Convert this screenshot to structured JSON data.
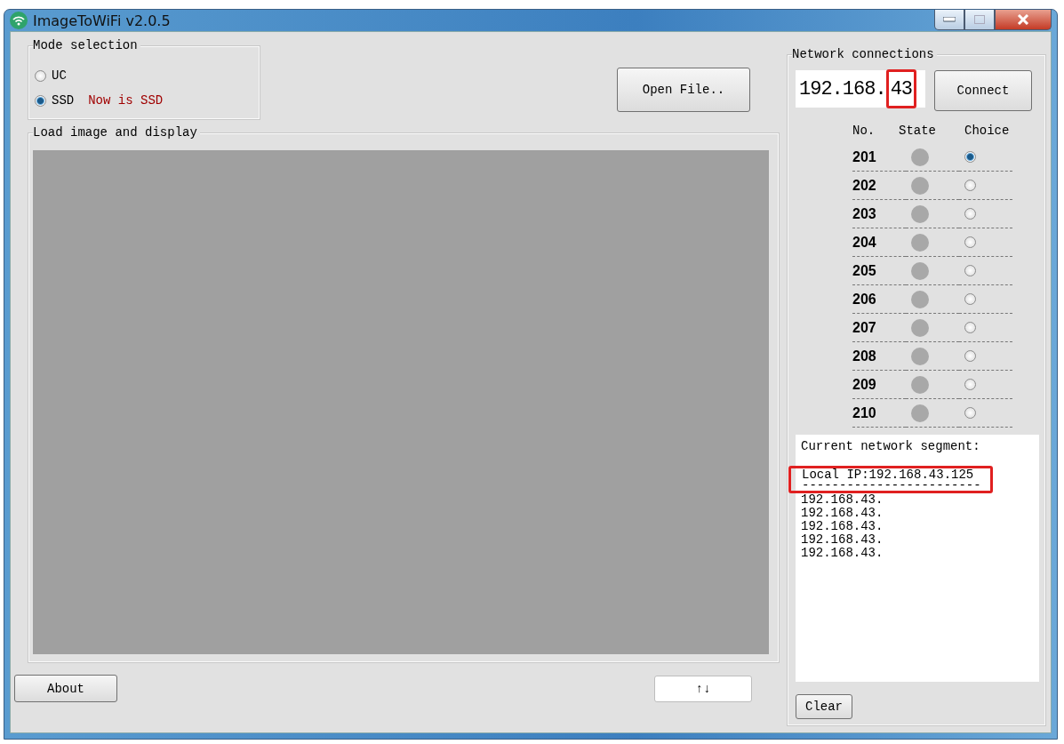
{
  "window": {
    "title": "ImageToWiFi v2.0.5"
  },
  "mode_selection": {
    "title": "Mode selection",
    "options": [
      {
        "label": "UC",
        "selected": false
      },
      {
        "label": "SSD",
        "selected": true
      }
    ],
    "status": "Now is SSD"
  },
  "open_file_button": "Open File..",
  "display": {
    "title": "Load image and display"
  },
  "about_button": "About",
  "swap_button": "↑↓",
  "network": {
    "title": "Network connections",
    "ip_field": {
      "value": "192.168.",
      "suffix": "43",
      "highlighted": true
    },
    "connect_button": "Connect",
    "columns": [
      "No.",
      "State",
      "Choice"
    ],
    "devices": [
      {
        "no": "201",
        "online": false,
        "selected": true
      },
      {
        "no": "202",
        "online": false,
        "selected": false
      },
      {
        "no": "203",
        "online": false,
        "selected": false
      },
      {
        "no": "204",
        "online": false,
        "selected": false
      },
      {
        "no": "205",
        "online": false,
        "selected": false
      },
      {
        "no": "206",
        "online": false,
        "selected": false
      },
      {
        "no": "207",
        "online": false,
        "selected": false
      },
      {
        "no": "208",
        "online": false,
        "selected": false
      },
      {
        "no": "209",
        "online": false,
        "selected": false
      },
      {
        "no": "210",
        "online": false,
        "selected": false
      }
    ]
  },
  "log": {
    "heading": "Current network segment:",
    "local_ip": "Local IP:192.168.43.125",
    "separator": "------------------------",
    "local_highlighted": true,
    "lines": [
      "192.168.43.",
      "192.168.43.",
      "192.168.43.",
      "192.168.43.",
      "192.168.43."
    ]
  },
  "clear_button": "Clear"
}
